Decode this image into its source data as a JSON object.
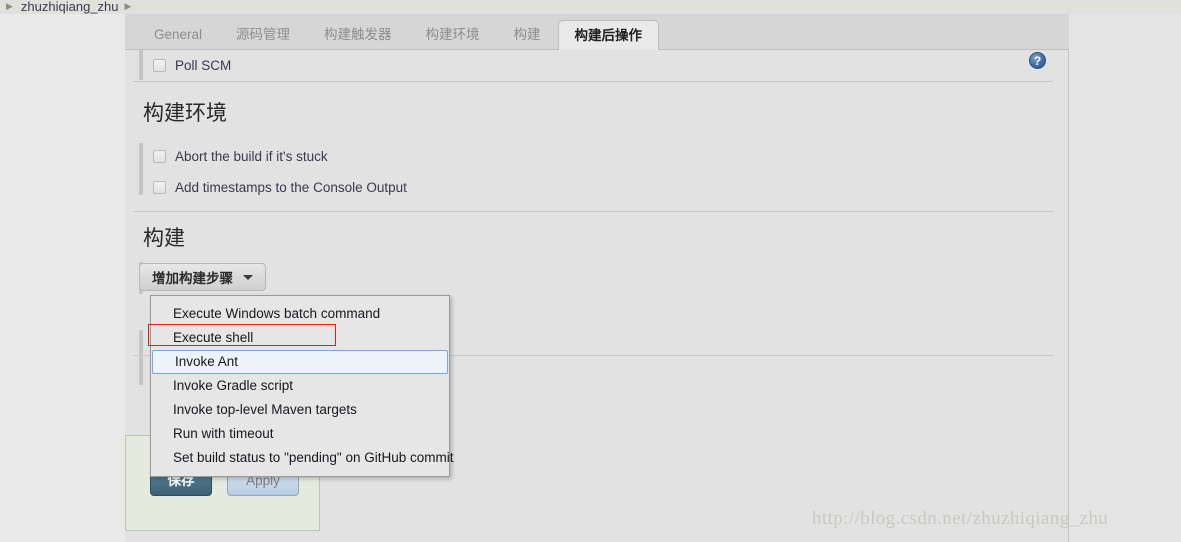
{
  "breadcrumb": {
    "arrow_glyph": "▶",
    "project": "zhuzhiqiang_zhu",
    "trailing_arrow_glyph": "▶"
  },
  "tabs": [
    {
      "label": "General",
      "active": false
    },
    {
      "label": "源码管理",
      "active": false
    },
    {
      "label": "构建触发器",
      "active": false
    },
    {
      "label": "构建环境",
      "active": false
    },
    {
      "label": "构建",
      "active": false
    },
    {
      "label": "构建后操作",
      "active": true
    }
  ],
  "help": {
    "glyph": "?"
  },
  "trigger_section": {
    "poll_scm_label": "Poll SCM",
    "poll_scm_checked": false
  },
  "build_env_section": {
    "title": "构建环境",
    "checkboxes": [
      {
        "label": "Abort the build if it's stuck",
        "checked": false
      },
      {
        "label": "Add timestamps to the Console Output",
        "checked": false
      }
    ]
  },
  "build_section": {
    "title": "构建",
    "add_step_button": "增加构建步骤",
    "menu_items": [
      {
        "label": "Execute Windows batch command",
        "state": "normal"
      },
      {
        "label": "Execute shell",
        "state": "annotated"
      },
      {
        "label": "Invoke Ant",
        "state": "hovered"
      },
      {
        "label": "Invoke Gradle script",
        "state": "normal"
      },
      {
        "label": "Invoke top-level Maven targets",
        "state": "normal"
      },
      {
        "label": "Run with timeout",
        "state": "normal"
      },
      {
        "label": "Set build status to \"pending\" on GitHub commit",
        "state": "normal"
      }
    ]
  },
  "footer": {
    "save_label": "保存",
    "apply_label": "Apply"
  },
  "watermark": "http://blog.csdn.net/zhuzhiqiang_zhu",
  "colors": {
    "page_bg": "#e3e3e3",
    "panel_bg": "#e2e2e2",
    "tabstrip_bg": "#d6d6d6",
    "active_tab_bg": "#e9e9e9",
    "breadcrumb_bg": "#dfe1da",
    "save_button": "#3d6275",
    "apply_button": "#b9cde3",
    "annotation_red": "#e02020",
    "hover_blue": "#7aa8dd",
    "save_panel_bg": "#e4eade",
    "help_blue": "#3f6ea3"
  }
}
